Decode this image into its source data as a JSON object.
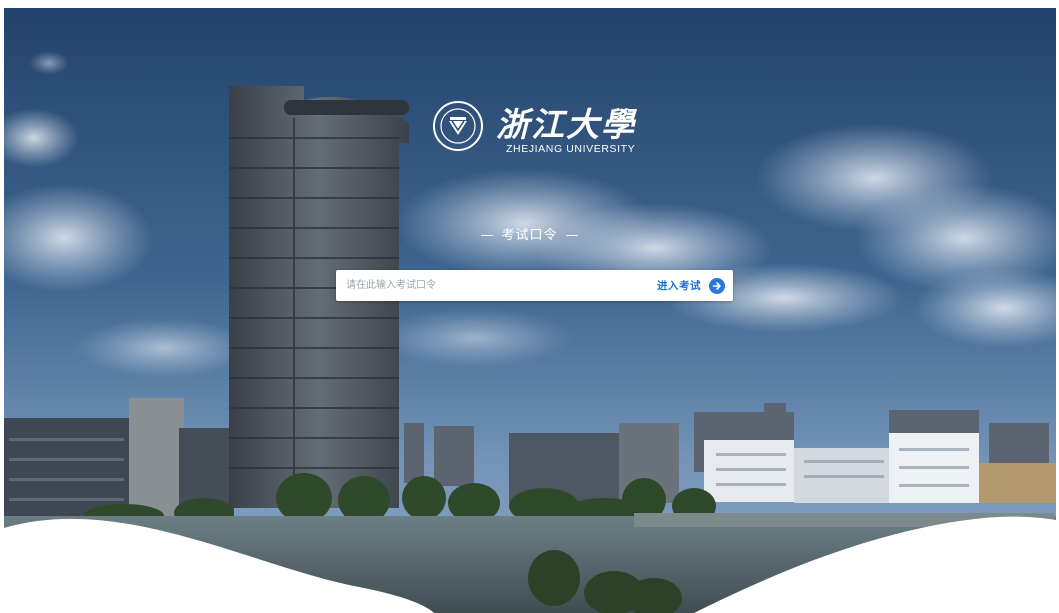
{
  "brand": {
    "name_cn": "浙江大學",
    "name_en": "ZHEJIANG UNIVERSITY",
    "emblem_icon": "university-emblem-icon"
  },
  "exam": {
    "title": "考试口令",
    "input_placeholder": "请在此输入考试口令",
    "input_value": "",
    "enter_label": "进入考试",
    "enter_icon": "arrow-right-circle-icon"
  },
  "colors": {
    "accent": "#2a76e0",
    "accent_text": "#1f6fd1",
    "sky_top": "#27466f",
    "sky_bottom": "#6f8fb4",
    "background": "#ffffff"
  }
}
